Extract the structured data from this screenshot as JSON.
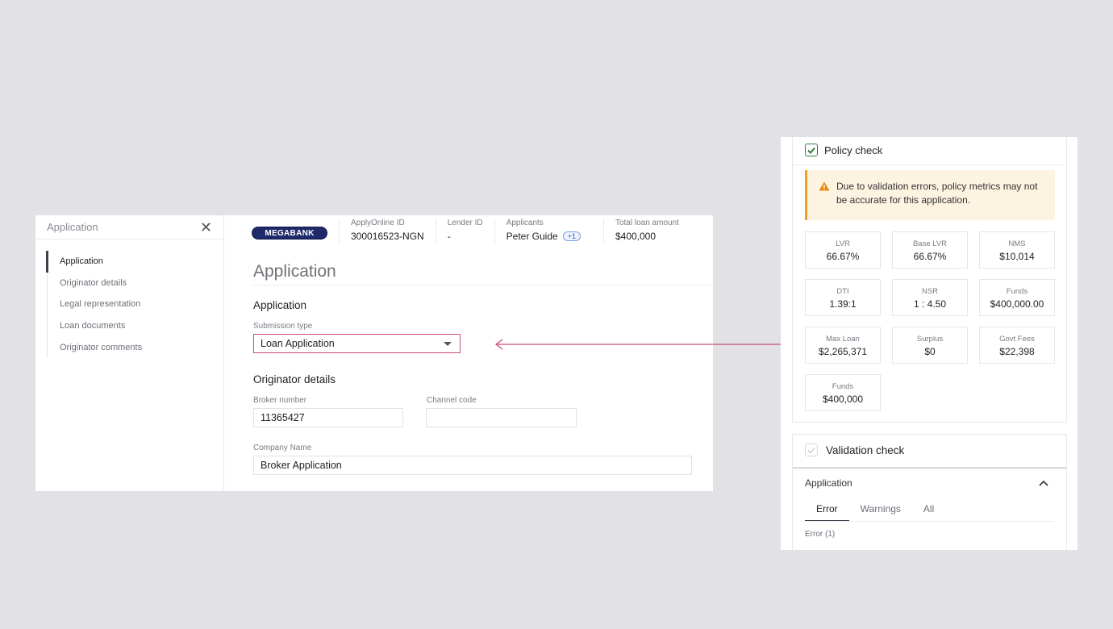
{
  "application_panel": {
    "sidebar": {
      "title": "Application",
      "close_icon": "close-icon",
      "items": [
        {
          "label": "Application",
          "active": true
        },
        {
          "label": "Originator details",
          "active": false
        },
        {
          "label": "Legal representation",
          "active": false
        },
        {
          "label": "Loan documents",
          "active": false
        },
        {
          "label": "Originator comments",
          "active": false
        }
      ]
    },
    "header": {
      "logo_text": "MEGABANK",
      "applyonline_label": "ApplyOnline ID",
      "applyonline_value": "300016523-NGN",
      "lender_label": "Lender ID",
      "lender_value": "-",
      "applicants_label": "Applicants",
      "applicants_value": "Peter Guide",
      "applicants_extra": "+1",
      "total_label": "Total loan amount",
      "total_value": "$400,000"
    },
    "page_title": "Application",
    "section_application": "Application",
    "submission_type_label": "Submission type",
    "submission_type_value": "Loan Application",
    "section_originator": "Originator details",
    "broker_number_label": "Broker number",
    "broker_number_value": "11365427",
    "channel_code_label": "Channel code",
    "channel_code_value": "",
    "company_name_label": "Company Name",
    "company_name_value": "Broker Application"
  },
  "connector_color": "#c94d6b",
  "policy_panel": {
    "policy_title": "Policy check",
    "alert_text": "Due to validation errors, policy metrics may not be accurate for this application.",
    "alert_icon": "warning-icon",
    "metrics": [
      {
        "label": "LVR",
        "value": "66.67%"
      },
      {
        "label": "Base LVR",
        "value": "66.67%"
      },
      {
        "label": "NMS",
        "value": "$10,014"
      },
      {
        "label": "DTI",
        "value": "1.39:1"
      },
      {
        "label": "NSR",
        "value": "1 : 4.50"
      },
      {
        "label": "Funds",
        "value": "$400,000.00"
      },
      {
        "label": "Max Loan",
        "value": "$2,265,371"
      },
      {
        "label": "Surplus",
        "value": "$0"
      },
      {
        "label": "Govt Fees",
        "value": "$22,398"
      },
      {
        "label": "Funds",
        "value": "$400,000"
      }
    ],
    "validation_title": "Validation check",
    "validation_section": "Application",
    "tabs": [
      {
        "label": "Error",
        "active": true
      },
      {
        "label": "Warnings",
        "active": false
      },
      {
        "label": "All",
        "active": false
      }
    ],
    "error_count": "Error (1)"
  }
}
